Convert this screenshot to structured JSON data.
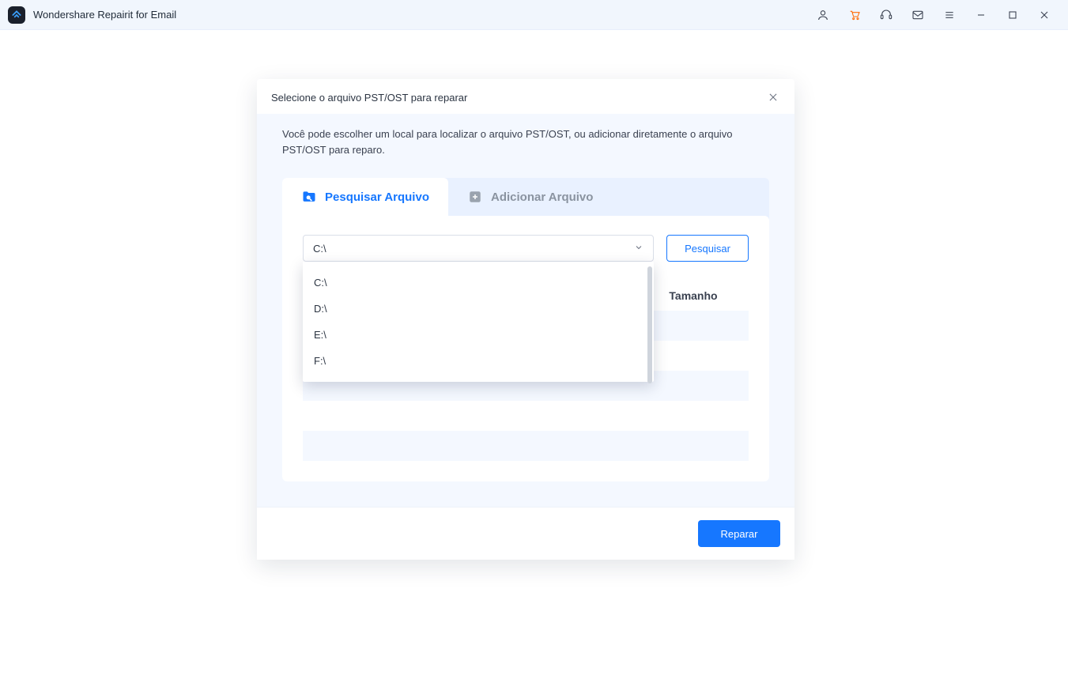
{
  "app": {
    "title": "Wondershare Repairit for Email"
  },
  "dialog": {
    "title": "Selecione o arquivo PST/OST para reparar",
    "description": "Você pode escolher um local para localizar o arquivo PST/OST, ou adicionar diretamente o arquivo PST/OST para reparo.",
    "tabs": {
      "search": "Pesquisar Arquivo",
      "add": "Adicionar Arquivo"
    },
    "drive_selected": "C:\\",
    "drive_options": [
      "C:\\",
      "D:\\",
      "E:\\",
      "F:\\"
    ],
    "search_button": "Pesquisar",
    "table": {
      "col_size": "Tamanho"
    },
    "repair_button": "Reparar"
  }
}
